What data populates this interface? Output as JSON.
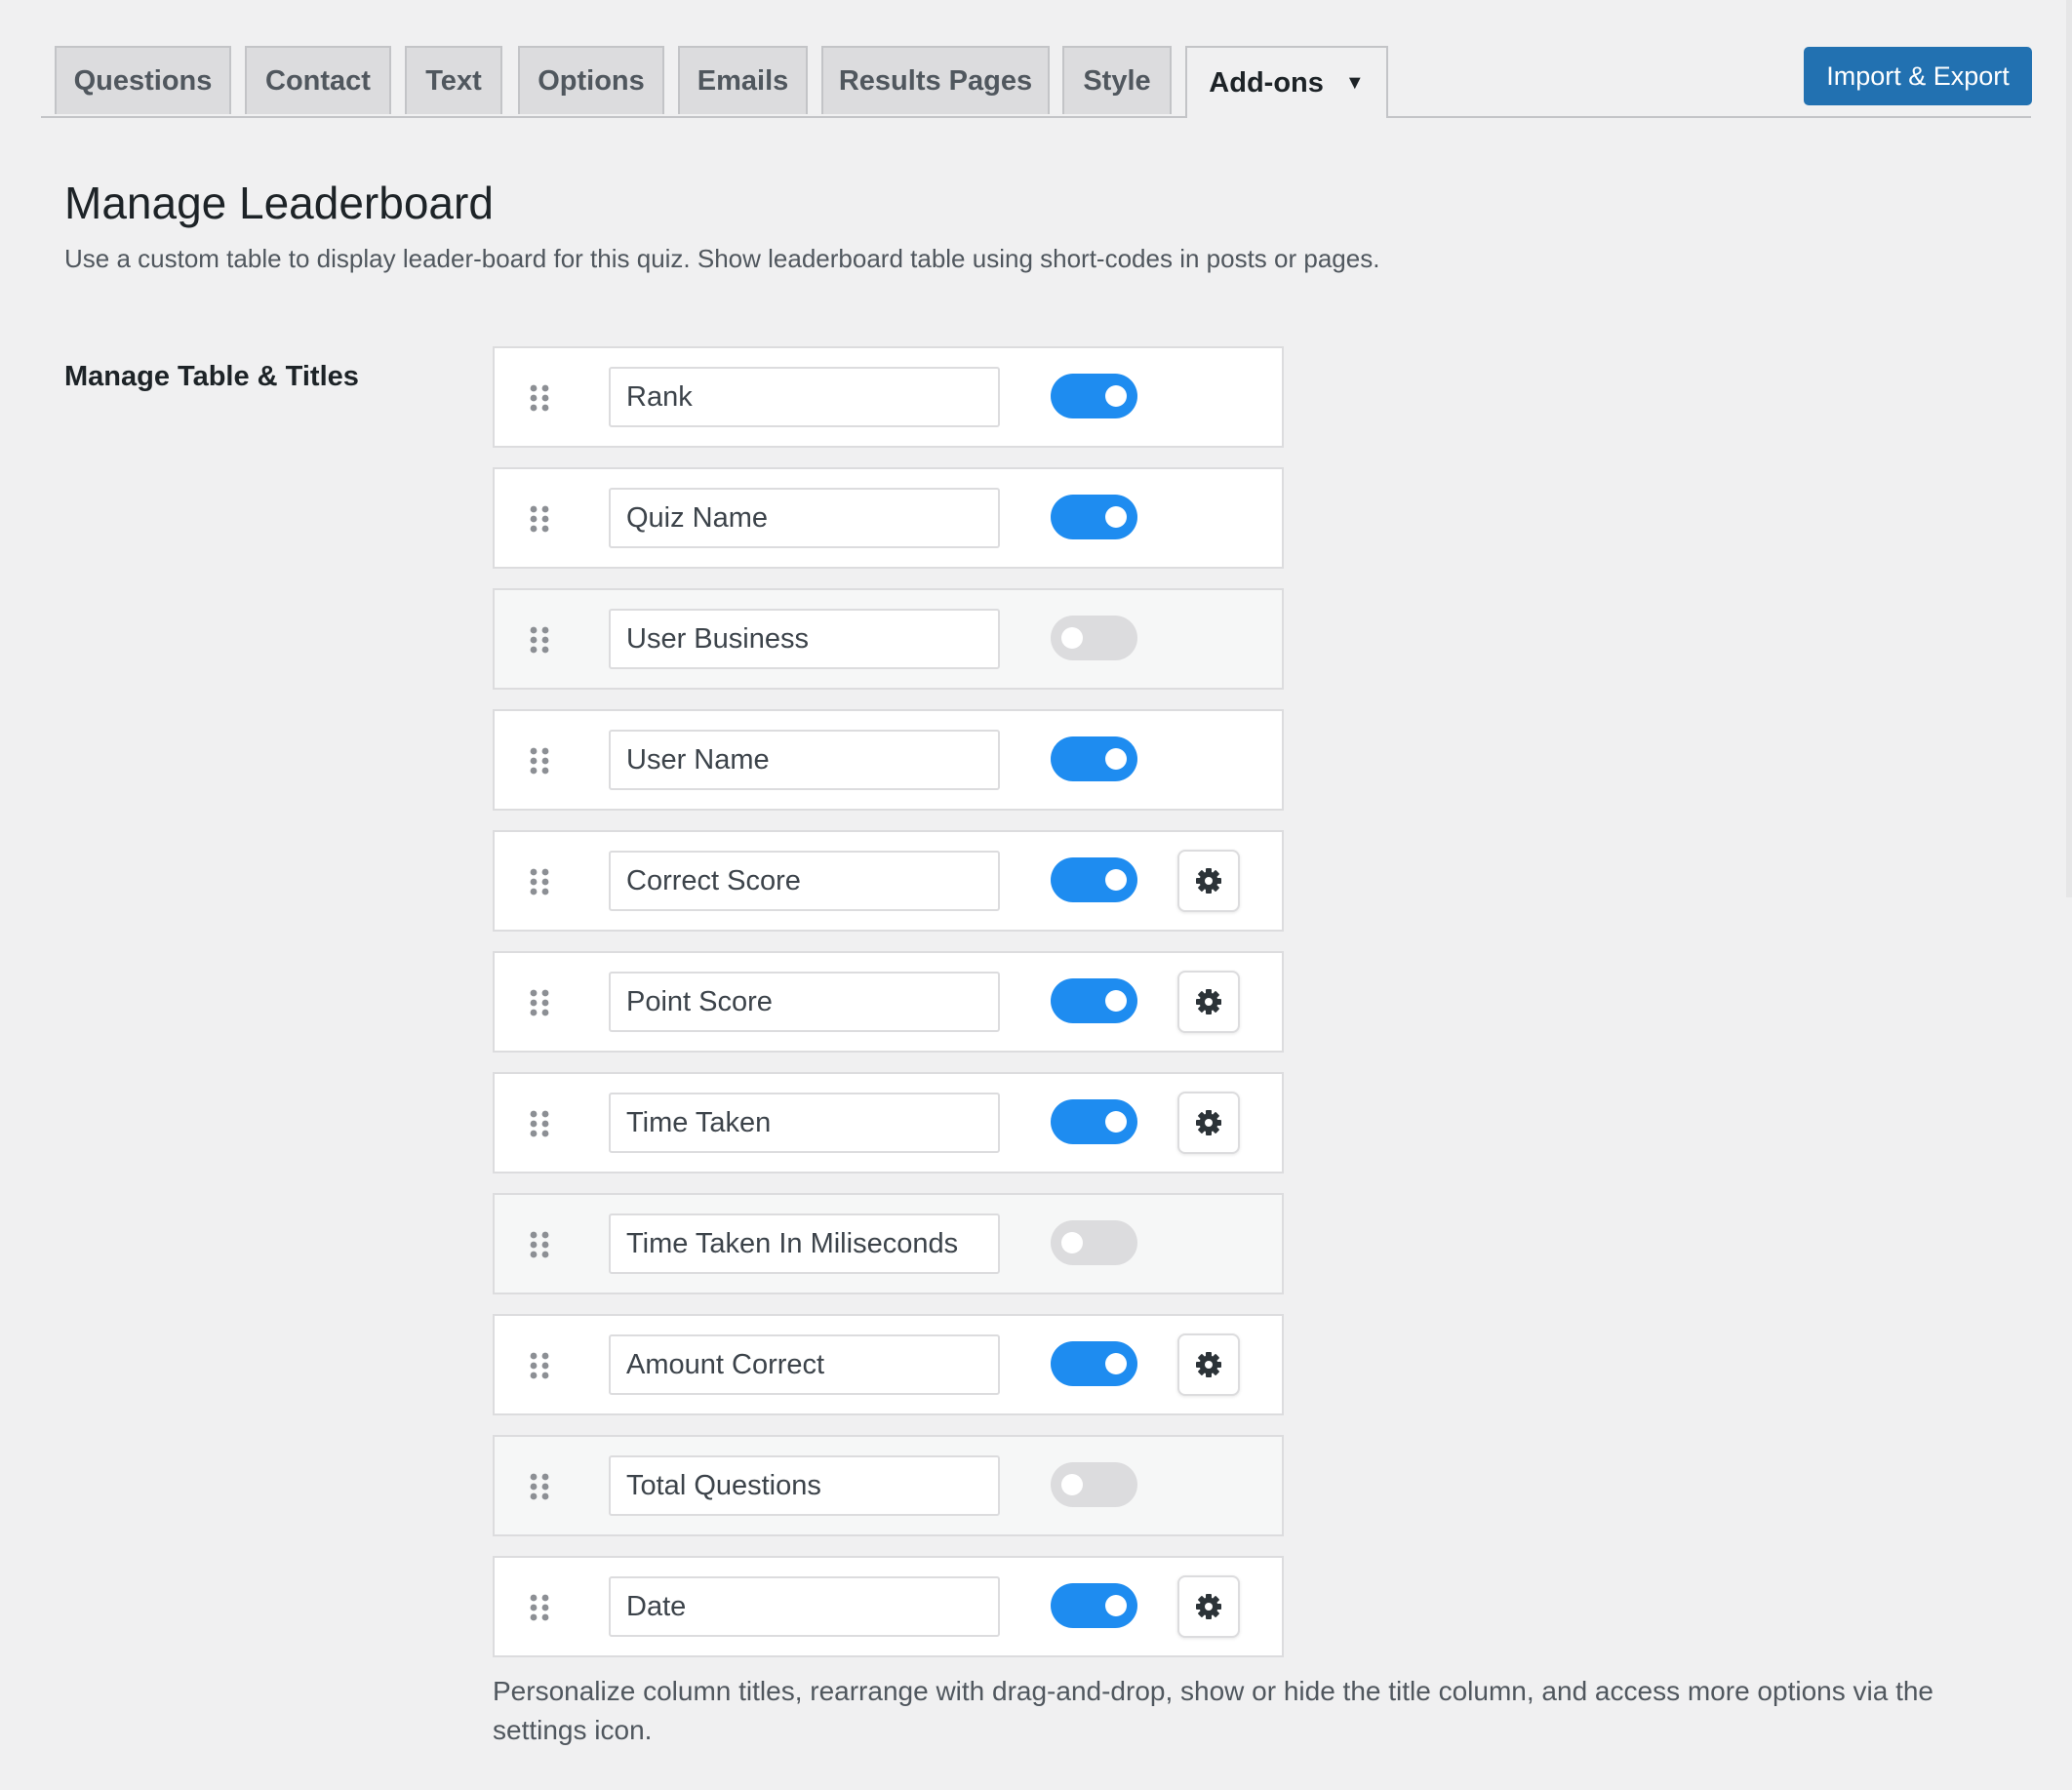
{
  "tabs": [
    {
      "label": "Questions"
    },
    {
      "label": "Contact"
    },
    {
      "label": "Text"
    },
    {
      "label": "Options"
    },
    {
      "label": "Emails"
    },
    {
      "label": "Results Pages"
    },
    {
      "label": "Style"
    },
    {
      "label": "Add-ons",
      "active": true,
      "caret": "▼"
    }
  ],
  "import_export_label": "Import & Export",
  "header": {
    "title": "Manage Leaderboard",
    "description": "Use a custom table to display leader-board for this quiz. Show leaderboard table using short-codes in posts or pages."
  },
  "section": {
    "label": "Manage Table & Titles"
  },
  "columns": [
    {
      "title": "Rank",
      "enabled": true,
      "has_settings": false
    },
    {
      "title": "Quiz Name",
      "enabled": true,
      "has_settings": false
    },
    {
      "title": "User Business",
      "enabled": false,
      "has_settings": false
    },
    {
      "title": "User Name",
      "enabled": true,
      "has_settings": false
    },
    {
      "title": "Correct Score",
      "enabled": true,
      "has_settings": true
    },
    {
      "title": "Point Score",
      "enabled": true,
      "has_settings": true
    },
    {
      "title": "Time Taken",
      "enabled": true,
      "has_settings": true
    },
    {
      "title": "Time Taken In Miliseconds",
      "enabled": false,
      "has_settings": false
    },
    {
      "title": "Amount Correct",
      "enabled": true,
      "has_settings": true
    },
    {
      "title": "Total Questions",
      "enabled": false,
      "has_settings": false
    },
    {
      "title": "Date",
      "enabled": true,
      "has_settings": true
    }
  ],
  "footer_note": "Personalize column titles, rearrange with drag-and-drop, show or hide the title column, and access more options via the settings icon.",
  "icons": {
    "drag": "drag-handle-icon",
    "settings": "gear-icon",
    "dropdown": "caret-down-icon"
  },
  "colors": {
    "accent": "#2271b1",
    "toggle_on": "#1e8cf0",
    "toggle_off": "#c3c4c7",
    "background": "#f0f0f1"
  }
}
